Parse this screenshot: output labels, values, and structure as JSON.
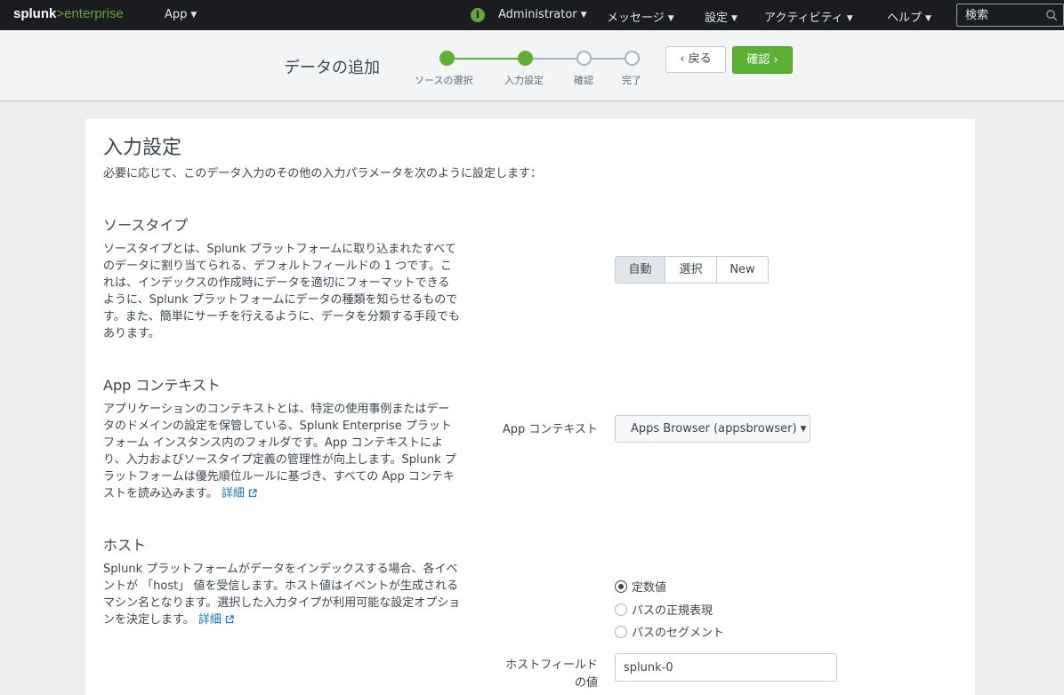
{
  "nav": {
    "logo_main": "splunk",
    "logo_gt": ">",
    "logo_suffix": "enterprise",
    "app_menu": "App",
    "info_icon": "i",
    "user": "Administrator",
    "messages": "メッセージ",
    "settings": "設定",
    "activity": "アクティビティ",
    "help": "ヘルプ",
    "search_placeholder": "検索"
  },
  "wizard": {
    "title": "データの追加",
    "steps": [
      {
        "label": "ソースの選択",
        "state": "done"
      },
      {
        "label": "入力設定",
        "state": "done"
      },
      {
        "label": "確認",
        "state": "todo"
      },
      {
        "label": "完了",
        "state": "todo"
      }
    ],
    "back_label": "‹ 戻る",
    "next_label": "確認 ›",
    "colors": {
      "done": "#5cb034",
      "todo": "#a7b1bb"
    }
  },
  "page": {
    "title": "入力設定",
    "intro": "必要に応じて、このデータ入力のその他の入力パラメータを次のように設定します："
  },
  "sourcetype": {
    "title": "ソースタイプ",
    "desc": "ソースタイプとは、Splunk プラットフォームに取り込まれたすべてのデータに割り当てられる、デフォルトフィールドの 1 つです。これは、インデックスの作成時にデータを適切にフォーマットできるように、Splunk プラットフォームにデータの種類を知らせるものです。また、簡単にサーチを行えるように、データを分類する手段でもあります。",
    "options": [
      "自動",
      "選択",
      "New"
    ],
    "selected": "自動"
  },
  "appcontext": {
    "title": "App コンテキスト",
    "desc": "アプリケーションのコンテキストとは、特定の使用事例またはデータのドメインの設定を保管している、Splunk Enterprise プラットフォーム インスタンス内のフォルダです。App コンテキストにより、入力およびソースタイプ定義の管理性が向上します。Splunk プラットフォームは優先順位ルールに基づき、すべての App コンテキストを読み込みます。",
    "link": "詳細",
    "field_label": "App コンテキスト",
    "value": "Apps Browser (appsbrowser)"
  },
  "host": {
    "title": "ホスト",
    "desc": "Splunk プラットフォームがデータをインデックスする場合、各イベントが 「host」 値を受信します。ホスト値はイベントが生成されるマシン名となります。選択した入力タイプが利用可能な設定オプションを決定します。",
    "link": "詳細",
    "options": [
      "定数値",
      "パスの正規表現",
      "パスのセグメント"
    ],
    "selected": "定数値",
    "field_label": "ホストフィールドの値",
    "field_value": "splunk-0"
  }
}
